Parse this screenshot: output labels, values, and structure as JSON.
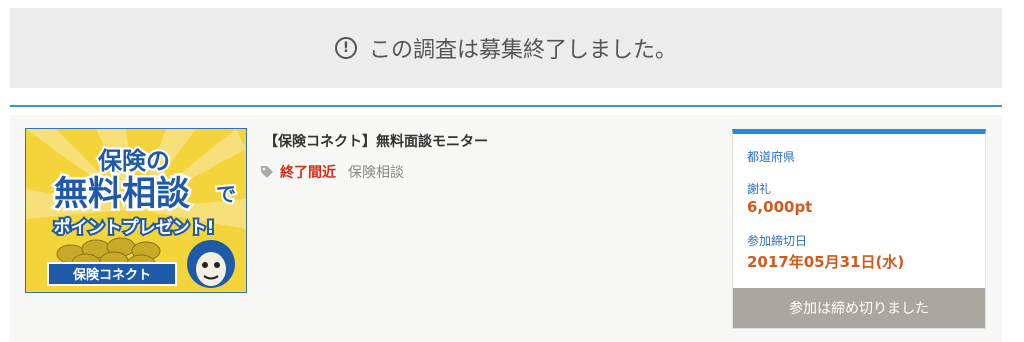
{
  "notice": {
    "icon": "exclamation-circle-icon",
    "text": "この調査は募集終了しました。"
  },
  "survey": {
    "title": "【保険コネクト】無料面談モニター",
    "tag_icon": "tag-icon",
    "status": "終了間近",
    "category": "保険相談",
    "banner": {
      "line1": "保険の",
      "line2": "無料相談",
      "line2_suffix": "で",
      "line3": "ポイントプレゼント!",
      "brand": "保険コネクト"
    }
  },
  "side_panel": {
    "prefecture_label": "都道府県",
    "reward_label": "謝礼",
    "reward_value": "6,000pt",
    "deadline_label": "参加締切日",
    "deadline_value": "2017年05月31日(水)",
    "closed_button": "参加は締め切りました"
  },
  "colors": {
    "accent_blue": "#2a88dc",
    "reward_orange": "#d35a1c",
    "status_red": "#d62b18",
    "button_gray": "#aaa6a2"
  }
}
